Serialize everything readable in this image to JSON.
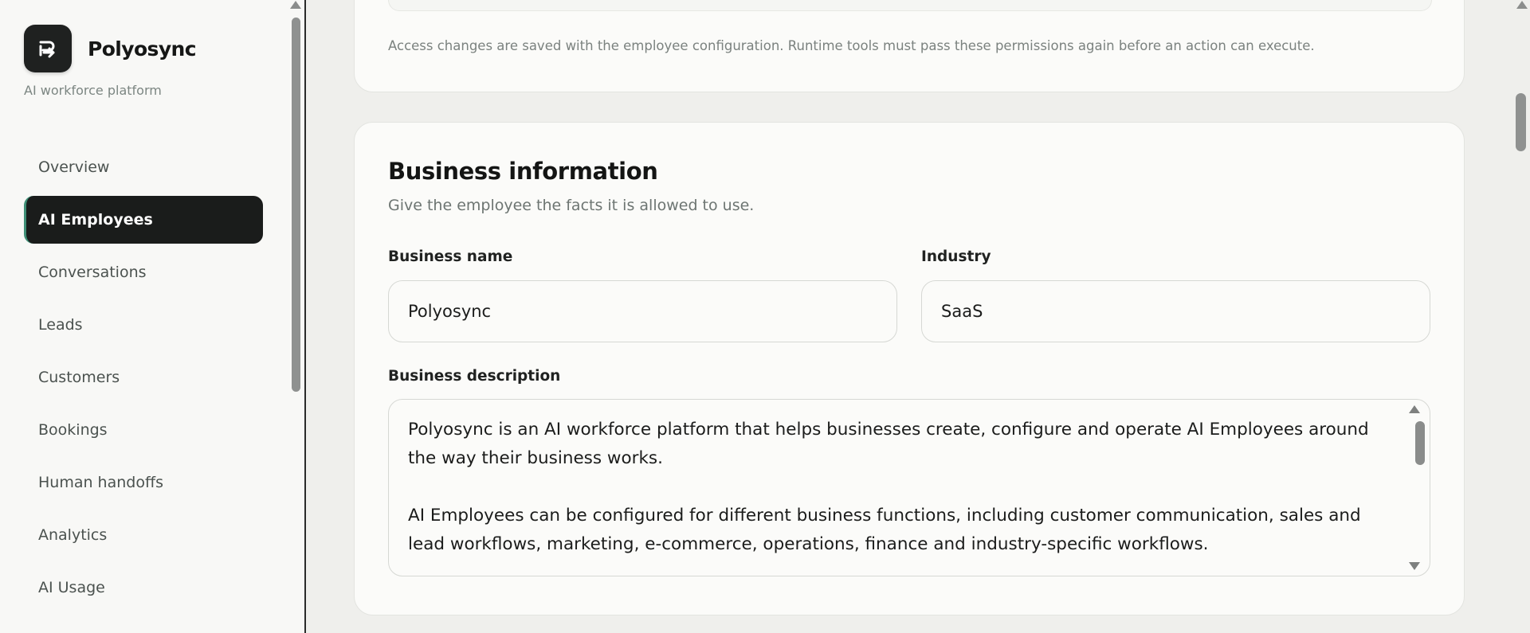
{
  "sidebar": {
    "brand_name": "Polyosync",
    "tagline": "AI workforce platform",
    "items": [
      {
        "label": "Overview",
        "active": false
      },
      {
        "label": "AI Employees",
        "active": true
      },
      {
        "label": "Conversations",
        "active": false
      },
      {
        "label": "Leads",
        "active": false
      },
      {
        "label": "Customers",
        "active": false
      },
      {
        "label": "Bookings",
        "active": false
      },
      {
        "label": "Human handoffs",
        "active": false
      },
      {
        "label": "Analytics",
        "active": false
      },
      {
        "label": "AI Usage",
        "active": false
      }
    ],
    "accent_color": "#3f8f76"
  },
  "access": {
    "note": "Access changes are saved with the employee configuration. Runtime tools must pass these permissions again before an action can execute."
  },
  "business": {
    "title": "Business information",
    "subtitle": "Give the employee the facts it is allowed to use.",
    "name_label": "Business name",
    "name_value": "Polyosync",
    "industry_label": "Industry",
    "industry_value": "SaaS",
    "description_label": "Business description",
    "description_paragraphs": [
      "Polyosync is an AI workforce platform that helps businesses create, configure and operate AI Employees around the way their business works.",
      "AI Employees can be configured for different business functions, including customer communication, sales and lead workflows, marketing, e-commerce, operations, finance and industry-specific workflows."
    ]
  }
}
